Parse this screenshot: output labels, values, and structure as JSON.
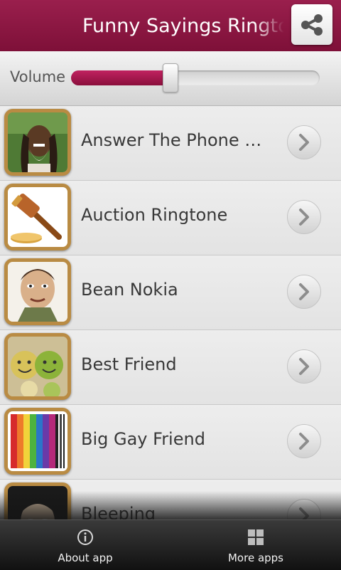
{
  "header": {
    "title": "Funny Sayings Ringtones",
    "share_icon": "share-icon"
  },
  "volume": {
    "label": "Volume",
    "level_percent": 40
  },
  "ringtones": [
    {
      "label": "Answer The Phone Ra...",
      "icon": "rasta-man-photo"
    },
    {
      "label": "Auction Ringtone",
      "icon": "gavel-icon"
    },
    {
      "label": "Bean Nokia",
      "icon": "mr-bean-caricature"
    },
    {
      "label": "Best Friend",
      "icon": "smiley-balls-photo"
    },
    {
      "label": "Big Gay Friend",
      "icon": "rainbow-stripes"
    },
    {
      "label": "Bleeping",
      "icon": "face-photo"
    }
  ],
  "bottom_bar": {
    "about_label": "About app",
    "about_icon": "info-icon",
    "more_label": "More apps",
    "more_icon": "grid-icon"
  },
  "colors": {
    "accent": "#8e1843",
    "header_bg": "#8e1843"
  }
}
